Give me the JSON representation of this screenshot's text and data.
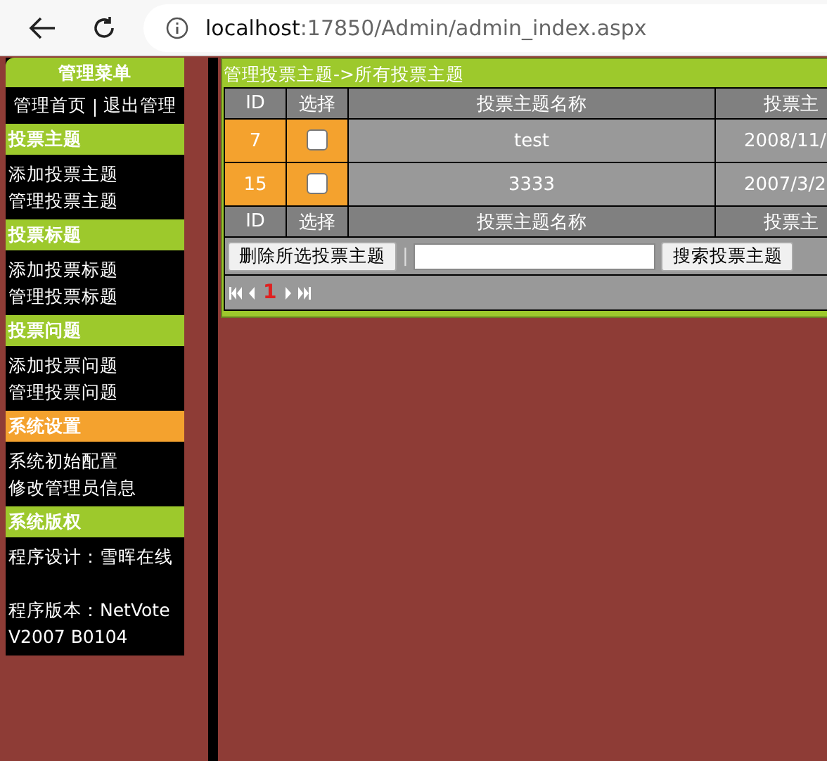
{
  "browser": {
    "host": "localhost",
    "path": ":17850/Admin/admin_index.aspx"
  },
  "sidebar": {
    "title": "管理菜单",
    "links": [
      "管理首页",
      "退出管理"
    ],
    "separator": "|",
    "sections": [
      {
        "heading": "投票主题",
        "highlighted": false,
        "items": [
          "添加投票主题",
          "管理投票主题"
        ]
      },
      {
        "heading": "投票标题",
        "highlighted": false,
        "items": [
          "添加投票标题",
          "管理投票标题"
        ]
      },
      {
        "heading": "投票问题",
        "highlighted": false,
        "items": [
          "添加投票问题",
          "管理投票问题"
        ]
      },
      {
        "heading": "系统设置",
        "highlighted": true,
        "items": [
          "系统初始配置",
          "修改管理员信息"
        ]
      },
      {
        "heading": "系统版权",
        "highlighted": false,
        "notes": [
          "程序设计：雪晖在线",
          "程序版本：NetVote V2007 B0104"
        ]
      }
    ]
  },
  "panel": {
    "title": "管理投票主题->所有投票主题",
    "table": {
      "columns": [
        "ID",
        "选择",
        "投票主题名称",
        "投票主"
      ],
      "rows": [
        {
          "id": "7",
          "checked": false,
          "name": "test",
          "date": "2008/11/"
        },
        {
          "id": "15",
          "checked": false,
          "name": "3333",
          "date": "2007/3/2"
        }
      ],
      "footer": [
        "ID",
        "选择",
        "投票主题名称",
        "投票主"
      ]
    },
    "delete_button": "删除所选投票主题",
    "separator": "|",
    "search_button": "搜索投票主题",
    "pager": {
      "current": "1"
    }
  }
}
